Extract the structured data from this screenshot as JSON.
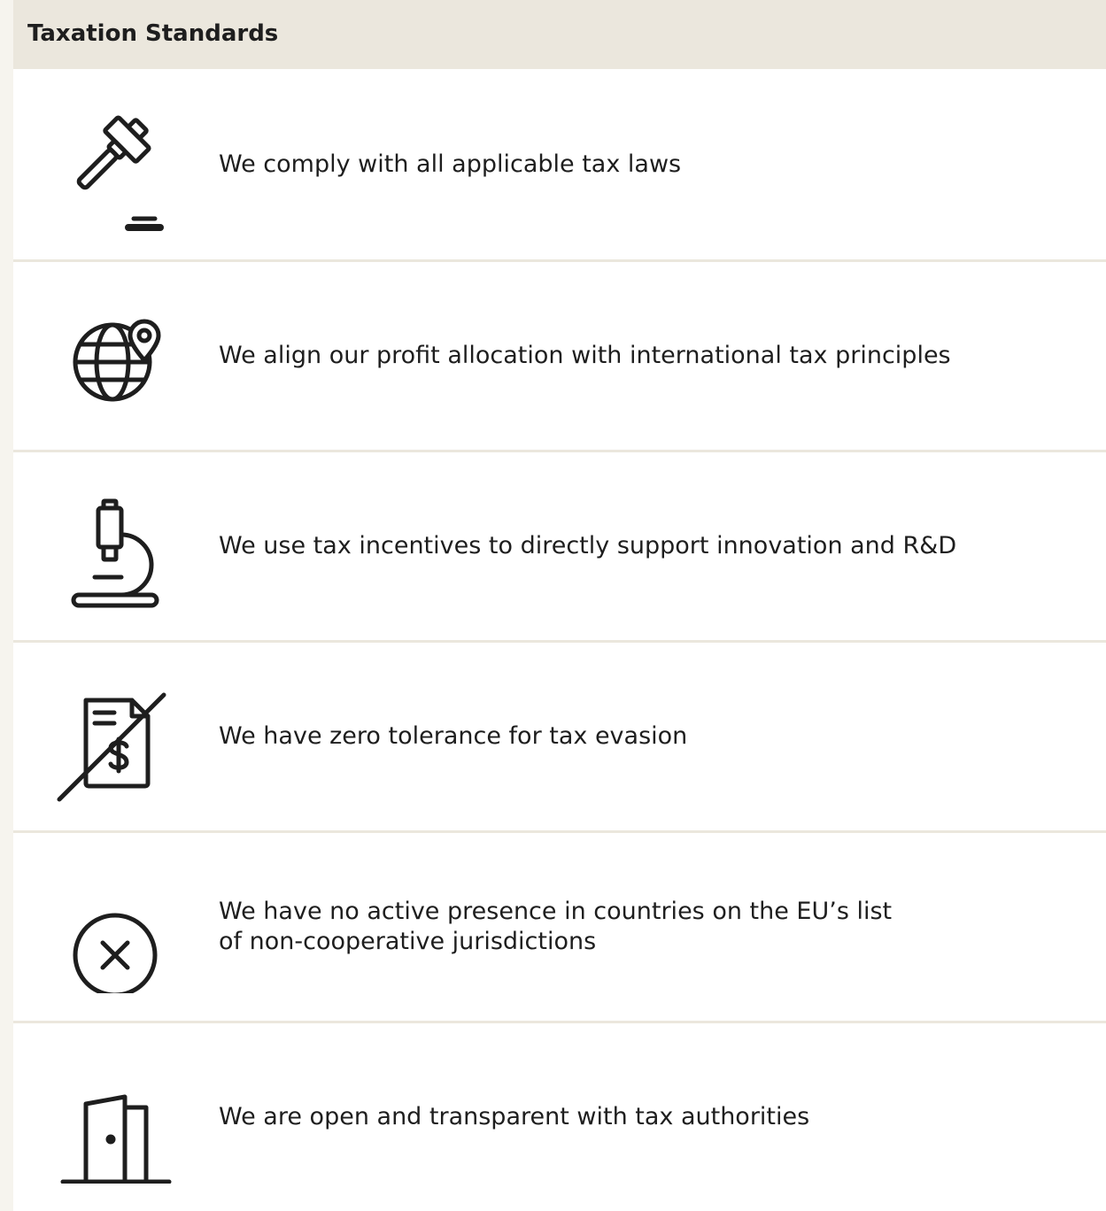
{
  "header": {
    "title": "Taxation Standards"
  },
  "rows": [
    {
      "icon": "gavel-icon",
      "lines": [
        "We comply with all applicable tax laws"
      ]
    },
    {
      "icon": "globe-pin-icon",
      "lines": [
        "We align our profit allocation with international tax principles"
      ]
    },
    {
      "icon": "microscope-icon",
      "lines": [
        "We use tax incentives to directly support innovation and R&D"
      ]
    },
    {
      "icon": "no-tax-evasion-icon",
      "lines": [
        "We have zero tolerance for tax evasion"
      ]
    },
    {
      "icon": "x-circle-icon",
      "lines": [
        "We have no active presence in countries on the EU’s list",
        "of non-cooperative jurisdictions"
      ]
    },
    {
      "icon": "door-icon",
      "lines": [
        "We are open and transparent with tax authorities"
      ]
    }
  ],
  "colors": {
    "header_bg": "#ebe7dd",
    "divider": "#ebe7dd",
    "text": "#1e1e1e",
    "page_bg": "#f6f4ee"
  }
}
